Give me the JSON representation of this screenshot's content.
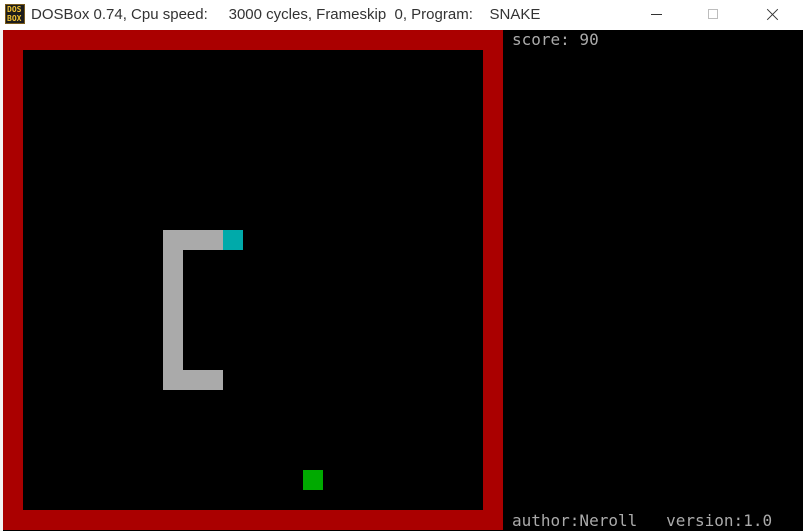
{
  "window": {
    "title": "DOSBox 0.74, Cpu speed:     3000 cycles, Frameskip  0, Program:    SNAKE",
    "icon_text": "DOS\nBOX"
  },
  "game": {
    "score_text": "score: 90",
    "footer_text": "author:Neroll   version:1.0",
    "colors": {
      "border": "#aa0000",
      "snake_body": "#aaaaaa",
      "snake_head": "#00aaaa",
      "food": "#00aa00",
      "text": "#aaaaaa"
    }
  }
}
